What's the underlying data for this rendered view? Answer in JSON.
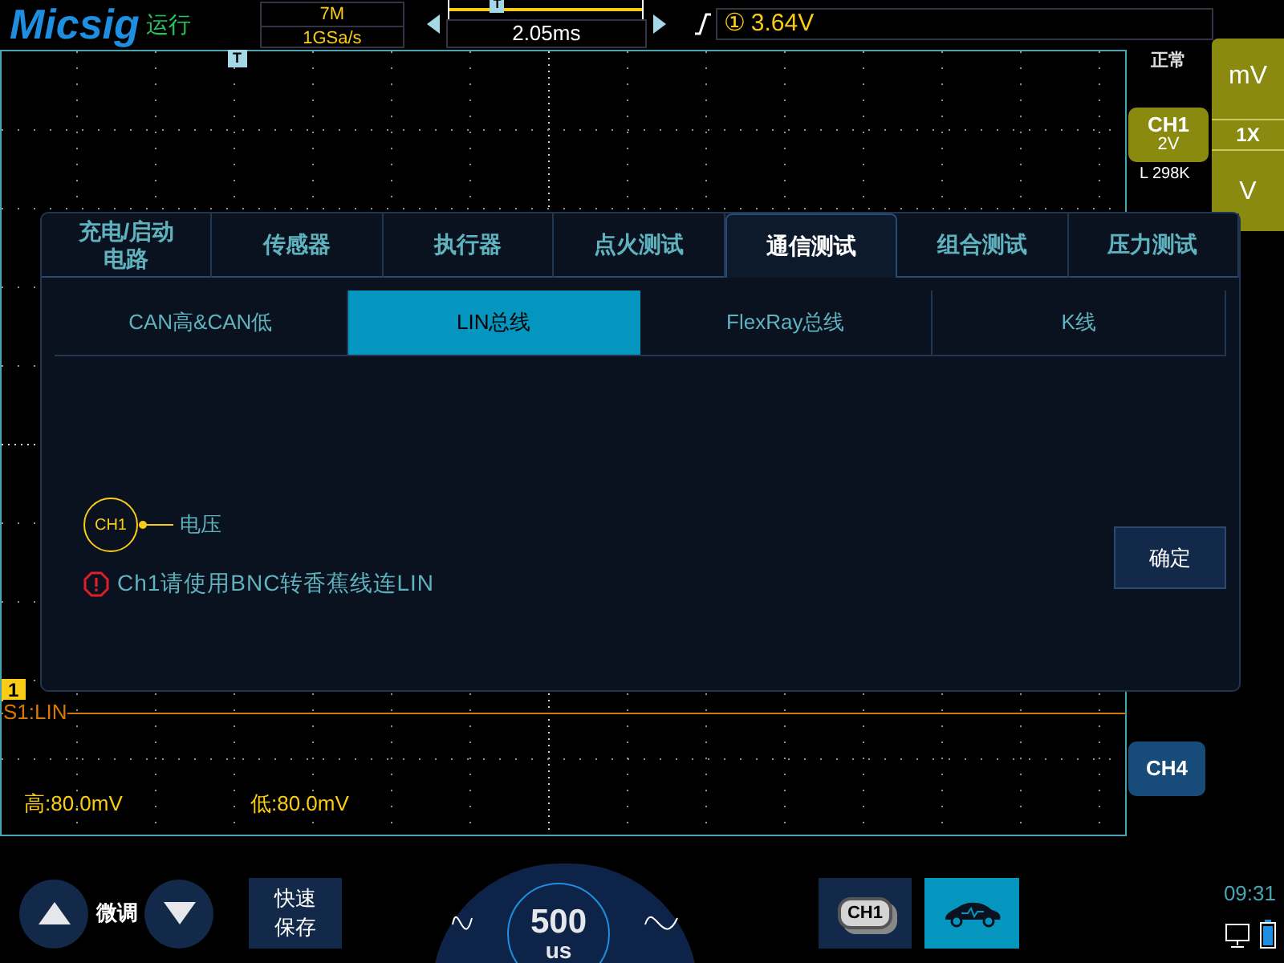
{
  "header": {
    "brand": "Micsig",
    "run_state": "运行",
    "memory_depth": "7M",
    "sample_rate": "1GSa/s",
    "position_marker": "T",
    "time_offset": "2.05ms",
    "trigger_source": "①",
    "trigger_level": "3.64V"
  },
  "grid": {
    "trigger_marker": "T"
  },
  "side": {
    "mode": "正常",
    "channel": {
      "label": "CH1",
      "scale": "2V",
      "impedance": "L 298K"
    },
    "units": [
      "mV",
      "1X",
      "V"
    ],
    "ch4": "CH4"
  },
  "dialog": {
    "tabs": [
      {
        "label": "充电/启动电路",
        "selected": false
      },
      {
        "label": "传感器",
        "selected": false
      },
      {
        "label": "执行器",
        "selected": false
      },
      {
        "label": "点火测试",
        "selected": false
      },
      {
        "label": "通信测试",
        "selected": true
      },
      {
        "label": "组合测试",
        "selected": false
      },
      {
        "label": "压力测试",
        "selected": false
      }
    ],
    "subtabs": [
      {
        "label": "CAN高&CAN低",
        "selected": false
      },
      {
        "label": "LIN总线",
        "selected": true
      },
      {
        "label": "FlexRay总线",
        "selected": false
      },
      {
        "label": "K线",
        "selected": false
      }
    ],
    "probe": {
      "channel": "CH1",
      "measure": "电压"
    },
    "warning": "Ch1请使用BNC转香蕉线连LIN",
    "confirm": "确定"
  },
  "waveform": {
    "marker": "1",
    "label": "S1:LIN",
    "high": "高:80.0mV",
    "low": "低:80.0mV"
  },
  "bottom": {
    "fine_tune": "微调",
    "quick_save": "快速保存",
    "timebase": "500",
    "timebase_unit": "us",
    "stack_channel": "CH1",
    "time": "09:31"
  }
}
